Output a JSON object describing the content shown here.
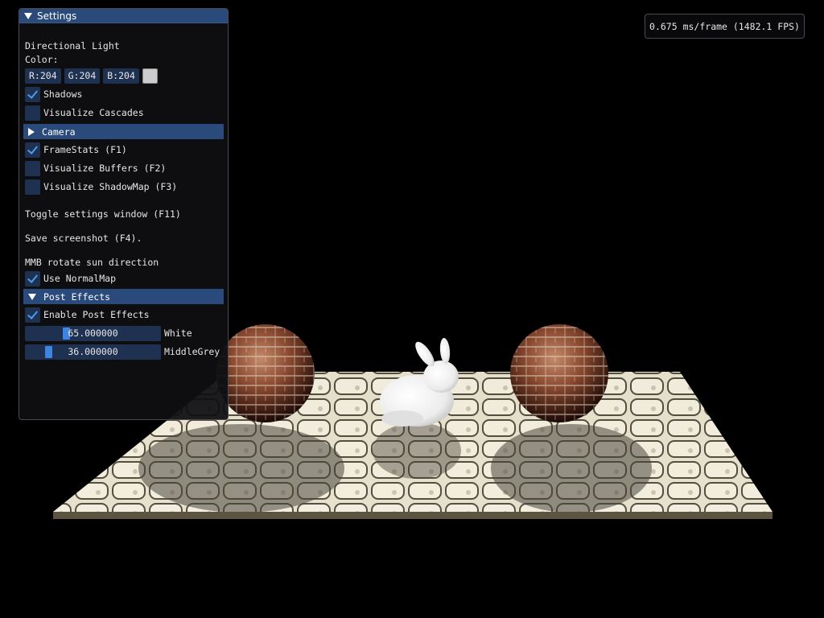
{
  "window": {
    "title": "Settings"
  },
  "fps": {
    "text": "0.675 ms/frame (1482.1 FPS)"
  },
  "light": {
    "heading": "Directional Light",
    "color_label": "Color:",
    "r": "R:204",
    "g": "G:204",
    "b": "B:204",
    "swatch_color": "#cccccc"
  },
  "checkboxes": {
    "shadows": {
      "label": "Shadows",
      "checked": true
    },
    "visualize_cascades": {
      "label": "Visualize Cascades",
      "checked": false
    },
    "framestats": {
      "label": "FrameStats (F1)",
      "checked": true
    },
    "visualize_buffers": {
      "label": "Visualize Buffers (F2)",
      "checked": false
    },
    "visualize_shadowmap": {
      "label": "Visualize ShadowMap (F3)",
      "checked": false
    },
    "use_normalmap": {
      "label": "Use NormalMap",
      "checked": true
    },
    "enable_post_effects": {
      "label": "Enable Post Effects",
      "checked": true
    }
  },
  "headers": {
    "camera": {
      "label": "Camera",
      "expanded": false
    },
    "post_effects": {
      "label": "Post Effects",
      "expanded": true
    }
  },
  "info": {
    "toggle": "Toggle settings window (F11)",
    "screenshot": "Save screenshot (F4).",
    "mmb": "MMB rotate sun direction"
  },
  "sliders": {
    "white": {
      "label": "White",
      "value_text": "65.000000",
      "fraction": 0.29
    },
    "middle_grey": {
      "label": "MiddleGrey",
      "value_text": "36.000000",
      "fraction": 0.15
    }
  },
  "colors": {
    "background": "#000000",
    "accent": "#4a9cf5",
    "header": "#294a7a",
    "frame": "#1f3150"
  }
}
